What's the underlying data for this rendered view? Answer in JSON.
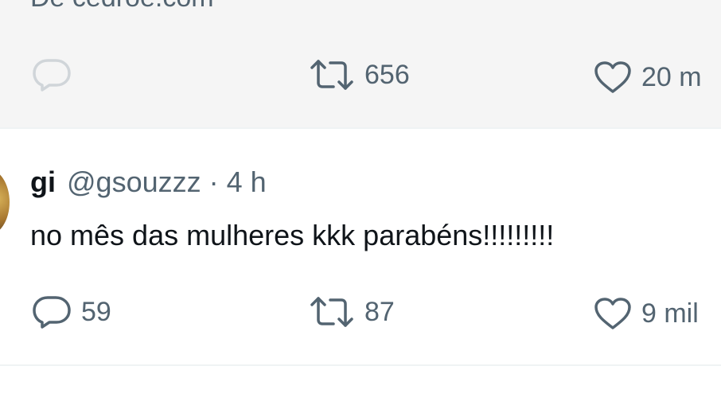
{
  "top_tweet": {
    "source_text": "De cedroe.com",
    "retweets": "656",
    "likes": "20 m"
  },
  "tweet": {
    "display_name": "gi",
    "handle": "@gsouzzz",
    "separator": "·",
    "time": "4 h",
    "text": "no mês das mulheres kkk parabéns!!!!!!!!!",
    "replies": "59",
    "retweets": "87",
    "likes": "9 mil"
  },
  "icons": {
    "reply": "reply-icon",
    "retweet": "retweet-icon",
    "like": "heart-icon"
  },
  "colors": {
    "text_primary": "#0f1419",
    "text_secondary": "#536471",
    "card_background": "#f5f5f5",
    "divider": "#eff3f4"
  }
}
